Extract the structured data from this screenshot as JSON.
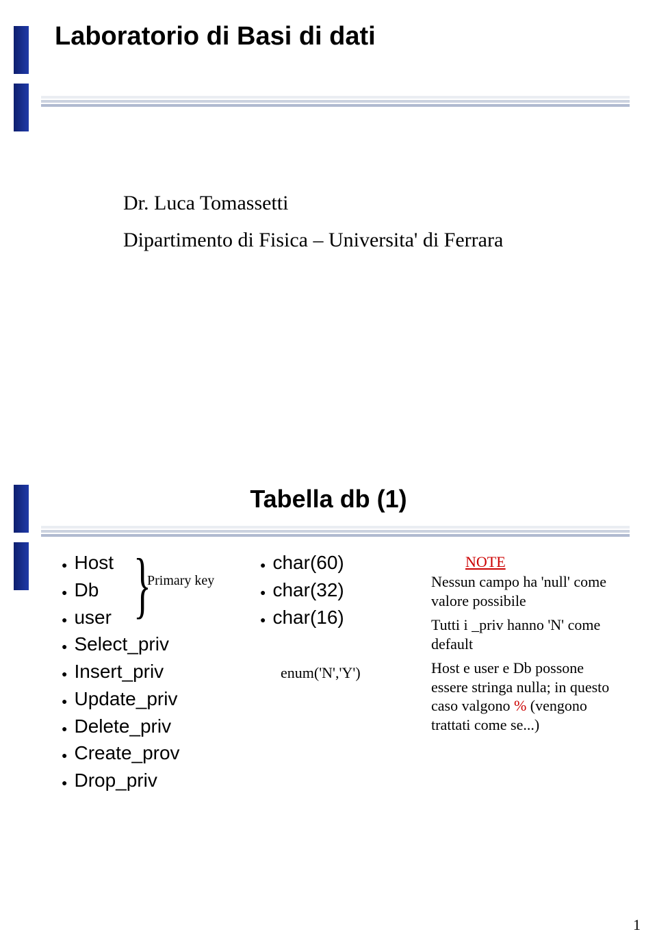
{
  "slide1": {
    "title": "Laboratorio di Basi di dati",
    "line1": "Dr. Luca Tomassetti",
    "line2": "Dipartimento di Fisica – Universita' di Ferrara"
  },
  "slide2": {
    "title": "Tabella db (1)",
    "fields": [
      "Host",
      "Db",
      "user",
      "Select_priv",
      "Insert_priv",
      "Update_priv",
      "Delete_priv",
      "Create_prov",
      "Drop_priv"
    ],
    "primary_key_label": "Primary key",
    "types": [
      "char(60)",
      "char(32)",
      "char(16)"
    ],
    "enum_label": "enum('N','Y')",
    "note_title": "NOTE",
    "note1": "Nessun campo ha 'null' come valore possibile",
    "note2": "Tutti i _priv hanno 'N' come default",
    "note3_a": "Host e user e Db possone essere stringa nulla; in questo caso valgono ",
    "note3_pct": "%",
    "note3_b": " (vengono trattati come se...)"
  },
  "page_number": "1"
}
